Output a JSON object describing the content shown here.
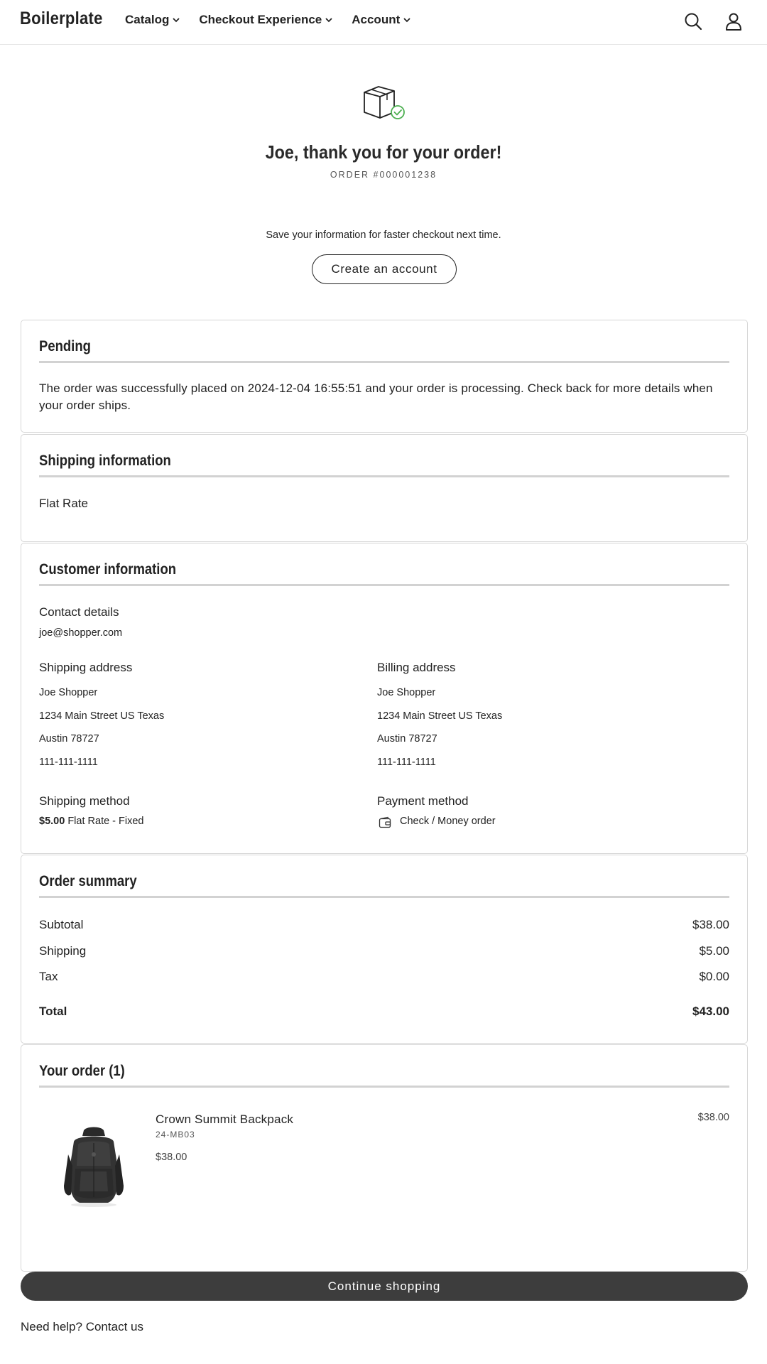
{
  "header": {
    "logo": "Boilerplate",
    "nav": [
      {
        "label": "Catalog",
        "icon": "chevron-down-icon"
      },
      {
        "label": "Checkout Experience",
        "icon": "chevron-down-icon"
      },
      {
        "label": "Account",
        "icon": "chevron-down-icon"
      }
    ],
    "icons": [
      "search-icon",
      "user-icon"
    ]
  },
  "hero": {
    "icon": "box-check-icon",
    "title": "Joe, thank you for your order!",
    "order_number": "ORDER #000001238",
    "save_info": "Save your information for faster checkout next time.",
    "create_account": "Create an account"
  },
  "pending": {
    "title": "Pending",
    "text": "The order was successfully placed on 2024-12-04 16:55:51 and your order is processing. Check back for more details when your order ships."
  },
  "shipping_info": {
    "title": "Shipping information",
    "text": "Flat Rate"
  },
  "customer": {
    "title": "Customer information",
    "contact_label": "Contact details",
    "email": "joe@shopper.com",
    "shipping_address": {
      "label": "Shipping address",
      "lines": [
        "Joe  Shopper",
        "1234 Main Street  US  Texas",
        "Austin  78727",
        "111-111-1111"
      ]
    },
    "billing_address": {
      "label": "Billing address",
      "lines": [
        "Joe  Shopper",
        "1234 Main Street  US  Texas",
        "Austin  78727",
        "111-111-1111"
      ]
    },
    "shipping_method": {
      "label": "Shipping method",
      "price": "$5.00",
      "name": "Flat Rate - Fixed"
    },
    "payment_method": {
      "label": "Payment method",
      "icon": "wallet-icon",
      "name": "Check / Money order"
    }
  },
  "summary": {
    "title": "Order summary",
    "rows": [
      {
        "label": "Subtotal",
        "value": "$38.00"
      },
      {
        "label": "Shipping",
        "value": "$5.00"
      },
      {
        "label": "Tax",
        "value": "$0.00"
      }
    ],
    "total": {
      "label": "Total",
      "value": "$43.00"
    }
  },
  "order_items": {
    "title": "Your order (1)",
    "items": [
      {
        "name": "Crown Summit Backpack",
        "sku": "24-MB03",
        "price": "$38.00",
        "row_total": "$38.00"
      }
    ]
  },
  "footer": {
    "continue": "Continue shopping",
    "help_prefix": "Need help?",
    "help_link": "Contact us"
  },
  "colors": {
    "accent_green": "#4caf50",
    "button_dark": "#3d3d3d",
    "rule": "#d2d2d2"
  }
}
